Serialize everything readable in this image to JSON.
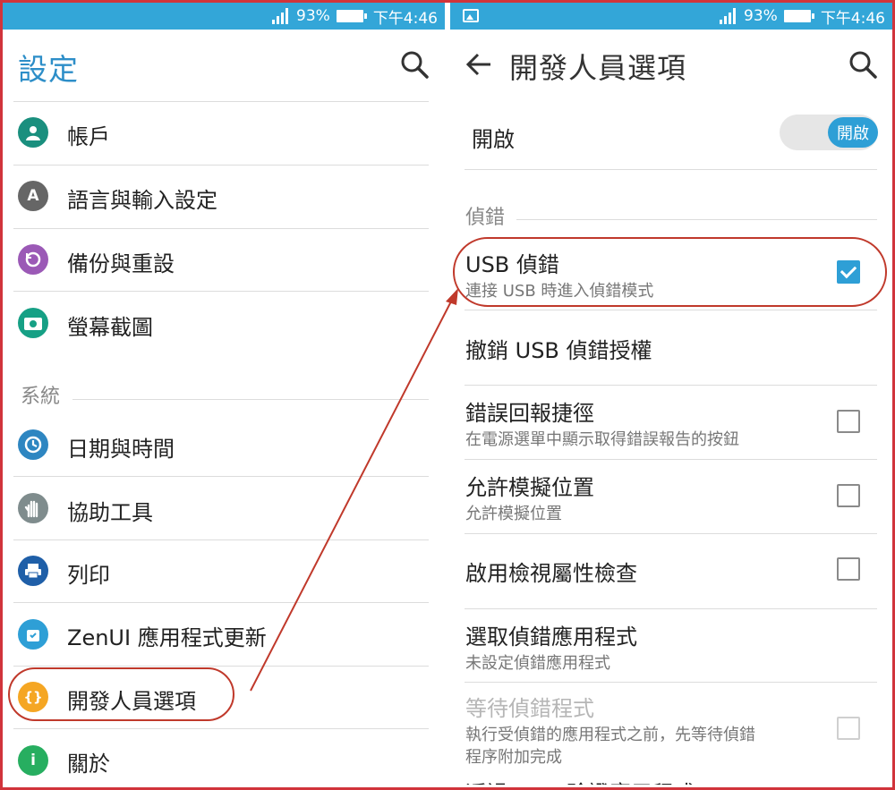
{
  "status_bar": {
    "battery": "93%",
    "time": "下午4:46"
  },
  "left": {
    "title": "設定",
    "items": [
      {
        "label": "帳戶",
        "icon": "account-icon",
        "color": "#1a8f7e"
      },
      {
        "label": "語言與輸入設定",
        "icon": "language-icon",
        "color": "#666666"
      },
      {
        "label": "備份與重設",
        "icon": "backup-icon",
        "color": "#9b59b6"
      },
      {
        "label": "螢幕截圖",
        "icon": "screenshot-icon",
        "color": "#16a085"
      }
    ],
    "section": "系統",
    "system_items": [
      {
        "label": "日期與時間",
        "icon": "clock-icon",
        "color": "#2e86c1"
      },
      {
        "label": "協助工具",
        "icon": "hand-icon",
        "color": "#7f8c8d"
      },
      {
        "label": "列印",
        "icon": "print-icon",
        "color": "#1f5fa8"
      },
      {
        "label": "ZenUI 應用程式更新",
        "icon": "update-icon",
        "color": "#2e9fd6"
      },
      {
        "label": "開發人員選項",
        "icon": "developer-icon",
        "color": "#f5a623"
      },
      {
        "label": "關於",
        "icon": "info-icon",
        "color": "#27ae60"
      }
    ]
  },
  "right": {
    "title": "開發人員選項",
    "toggle_label": "開啟",
    "toggle_state": "開啟",
    "section": "偵錯",
    "options": [
      {
        "title": "USB 偵錯",
        "subtitle": "連接 USB 時進入偵錯模式",
        "checked": true
      },
      {
        "title": "撤銷 USB 偵錯授權",
        "subtitle": ""
      },
      {
        "title": "錯誤回報捷徑",
        "subtitle": "在電源選單中顯示取得錯誤報告的按鈕",
        "checked": false
      },
      {
        "title": "允許模擬位置",
        "subtitle": "允許模擬位置",
        "checked": false
      },
      {
        "title": "啟用檢視屬性檢查",
        "subtitle": "",
        "checked": false
      },
      {
        "title": "選取偵錯應用程式",
        "subtitle": "未設定偵錯應用程式"
      },
      {
        "title": "等待偵錯程式",
        "subtitle_line1": "執行受偵錯的應用程式之前，先等待偵錯",
        "subtitle_line2": "程序附加完成",
        "checked": false,
        "disabled": true
      },
      {
        "title": "透過 USB 驗證應用程式"
      }
    ]
  },
  "colors": {
    "accent": "#2e9fd6",
    "status_bar": "#33a6d8",
    "highlight": "#c0392b"
  }
}
